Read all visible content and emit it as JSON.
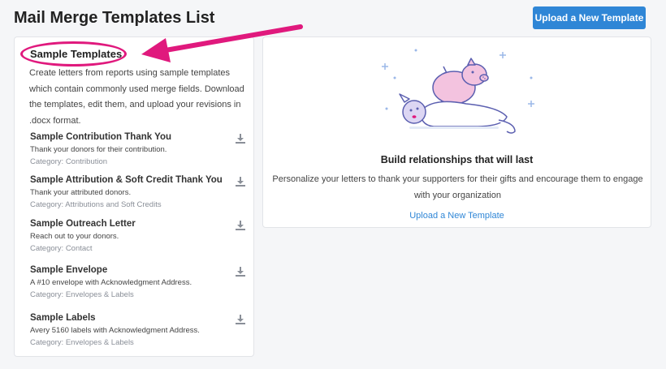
{
  "page": {
    "title": "Mail Merge Templates List",
    "upload_button_label": "Upload a New Template"
  },
  "sample_templates": {
    "heading": "Sample Templates",
    "description": "Create letters from reports using sample templates which contain commonly used merge fields. Download the templates, edit them, and upload your revisions in .docx format.",
    "items": [
      {
        "name": "Sample Contribution Thank You",
        "description": "Thank your donors for their contribution.",
        "category": "Category: Contribution"
      },
      {
        "name": "Sample Attribution & Soft Credit Thank You",
        "description": "Thank your attributed donors.",
        "category": "Category: Attributions and Soft Credits"
      },
      {
        "name": "Sample Outreach Letter",
        "description": "Reach out to your donors.",
        "category": "Category: Contact"
      },
      {
        "name": "Sample Envelope",
        "description": "A #10 envelope with Acknowledgment Address.",
        "category": "Category: Envelopes & Labels"
      },
      {
        "name": "Sample Labels",
        "description": "Avery 5160 labels with Acknowledgment Address.",
        "category": "Category: Envelopes & Labels"
      }
    ]
  },
  "empty_state": {
    "heading": "Build relationships that will last",
    "body": "Personalize your letters to thank your supporters for their gifts and encourage them to engage with your organization",
    "link_label": "Upload a New Template"
  },
  "icons": {
    "download": "download-icon",
    "annotation_arrow": "arrow-icon"
  },
  "colors": {
    "accent": "#2f86d6",
    "annotation": "#e0197d",
    "background": "#f5f6f8"
  }
}
